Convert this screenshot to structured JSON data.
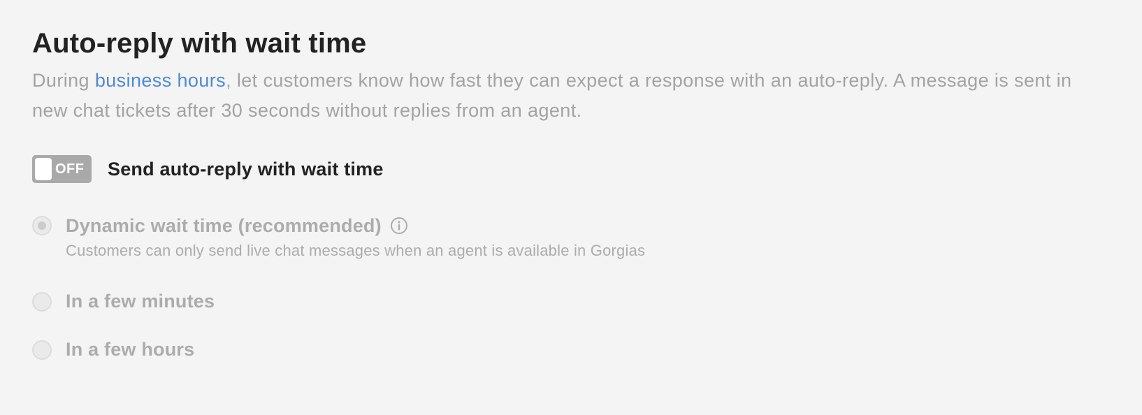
{
  "section": {
    "title": "Auto-reply with wait time",
    "description_before_link": "During ",
    "description_link": "business hours",
    "description_after_link": ", let customers know how fast they can expect a response with an auto-reply. A message is sent in new chat tickets after 30 seconds without replies from an agent."
  },
  "toggle": {
    "state_text": "OFF",
    "label": "Send auto-reply with wait time",
    "enabled": false
  },
  "options": {
    "dynamic": {
      "label": "Dynamic wait time (recommended)",
      "help": "Customers can only send live chat messages when an agent is available in Gorgias",
      "selected": true,
      "icon": "info-icon"
    },
    "minutes": {
      "label": "In a few minutes",
      "selected": false
    },
    "hours": {
      "label": "In a few hours",
      "selected": false
    }
  },
  "colors": {
    "link": "#4d8ad6",
    "toggle_off": "#a9a9a9",
    "disabled_text": "#acacac",
    "title": "#222222"
  }
}
